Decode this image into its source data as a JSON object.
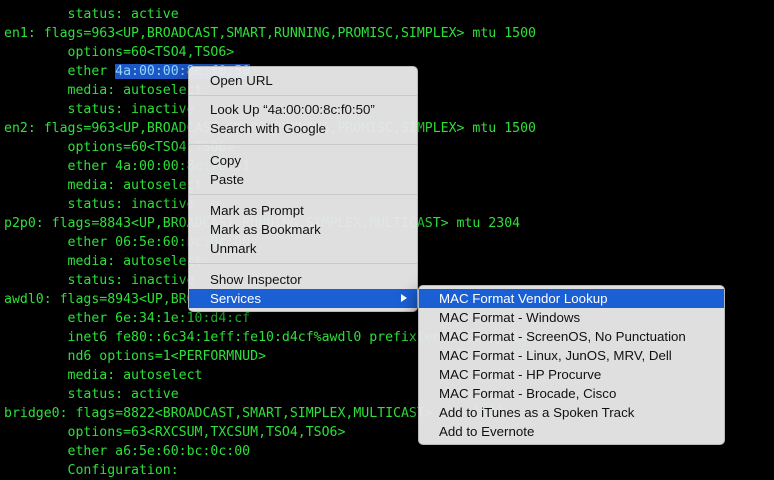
{
  "terminal": {
    "lines": [
      "        status: active",
      "en1: flags=963<UP,BROADCAST,SMART,RUNNING,PROMISC,SIMPLEX> mtu 1500",
      "        options=60<TSO4,TSO6>",
      "        ether ",
      "        media: autoselect",
      "        status: inactive",
      "en2: flags=963<UP,BROADCAST,SMART,RUNNING,PROMISC,SIMPLEX> mtu 1500",
      "        options=60<TSO4,TSO6>",
      "        ether 4a:00:00:8c:f0:51",
      "        media: autoselect",
      "        status: inactive",
      "p2p0: flags=8843<UP,BROADCAST,RUNNING,SIMPLEX,MULTICAST> mtu 2304",
      "        ether 06:5e:60:bc:0c:00",
      "        media: autoselect",
      "        status: inactive",
      "awdl0: flags=8943<UP,BROADCAST,RUNNING,PROMISC,SIMPLEX,MULTICAST> mtu 1484",
      "        ether 6e:34:1e:10:d4:cf",
      "        inet6 fe80::6c34:1eff:fe10:d4cf%awdl0 prefixlen 64 scopeid 0x9",
      "        nd6 options=1<PERFORMNUD>",
      "        media: autoselect",
      "        status: active",
      "bridge0: flags=8822<BROADCAST,SMART,SIMPLEX,MULTICAST> mtu 1500",
      "        options=63<RXCSUM,TXCSUM,TSO4,TSO6>",
      "        ether a6:5e:60:bc:0c:00",
      "        Configuration:"
    ],
    "selected_text": "4a:00:00:8c:f0:50"
  },
  "context_menu": {
    "open_url": "Open URL",
    "look_up": "Look Up “4a:00:00:8c:f0:50”",
    "search_google": "Search with Google",
    "copy": "Copy",
    "paste": "Paste",
    "mark_prompt": "Mark as Prompt",
    "mark_bookmark": "Mark as Bookmark",
    "unmark": "Unmark",
    "show_inspector": "Show Inspector",
    "services": "Services"
  },
  "services_menu": {
    "items": [
      "MAC Format Vendor Lookup",
      "MAC Format - Windows",
      "MAC Format - ScreenOS, No Punctuation",
      "MAC Format - Linux, JunOS, MRV, Dell",
      "MAC Format - HP Procurve",
      "MAC Format - Brocade, Cisco",
      "Add to iTunes as a Spoken Track",
      "Add to Evernote"
    ]
  },
  "colors": {
    "terminal_background": "#000000",
    "terminal_text": "#2de03a",
    "selection_background": "#1f56c5",
    "menu_highlight": "#1a5fd4"
  }
}
